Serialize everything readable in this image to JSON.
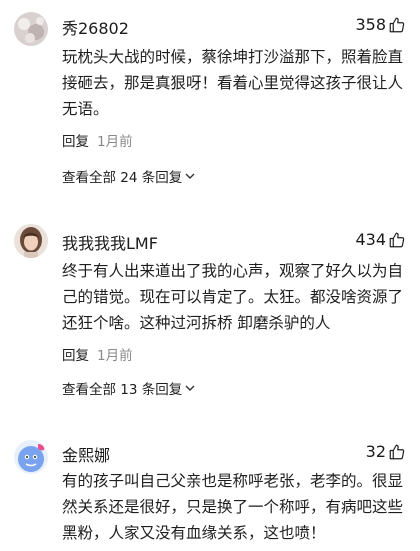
{
  "comments": [
    {
      "username": "秀26802",
      "likes": "358",
      "text": "玩枕头大战的时候，蔡徐坤打沙溢那下，照着脸直接砸去，那是真狠呀！看着心里觉得这孩子很让人无语。",
      "reply_label": "回复",
      "time": "1月前",
      "view_replies": "查看全部 24 条回复"
    },
    {
      "username": "我我我我LMF",
      "likes": "434",
      "text": "终于有人出来道出了我的心声，观察了好久以为自己的错觉。现在可以肯定了。太狂。都没啥资源了还狂个啥。这种过河拆桥 卸磨杀驴的人",
      "reply_label": "回复",
      "time": "1月前",
      "view_replies": "查看全部 13 条回复"
    },
    {
      "username": "金熙娜",
      "likes": "32",
      "text": "有的孩子叫自己父亲也是称呼老张，老李的。很显然关系还是很好，只是换了一个称呼，有病吧这些黑粉，人家又没有血缘关系，这也喷！"
    }
  ],
  "icons": {
    "like": "thumbs-up-icon",
    "expand": "chevron-down-icon"
  }
}
